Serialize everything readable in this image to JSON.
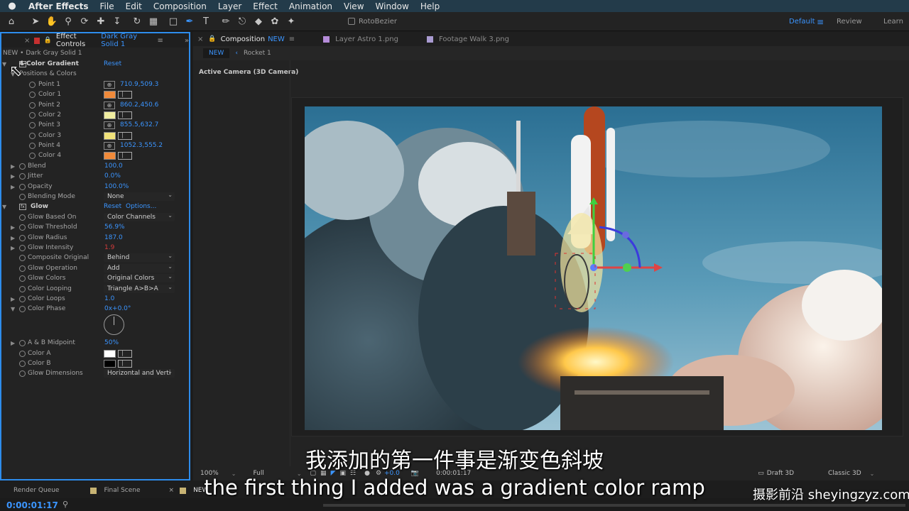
{
  "menubar": {
    "apple_icon": "apple-icon",
    "items": [
      "After Effects",
      "File",
      "Edit",
      "Composition",
      "Layer",
      "Effect",
      "Animation",
      "View",
      "Window",
      "Help"
    ]
  },
  "toolbar": {
    "rotobezier_label": "RotoBezier",
    "workspaces": {
      "default": "Default",
      "menu": "≡",
      "review": "Review",
      "learn": "Learn"
    }
  },
  "effect_controls": {
    "tab_title": "Effect Controls",
    "tab_layer": "Dark Gray Solid 1",
    "header": "NEW • Dark Gray Solid 1",
    "gradient": {
      "name": "4-Color Gradient",
      "reset": "Reset",
      "group": "Positions & Colors",
      "point1_label": "Point 1",
      "point1_value": "710.9,509.3",
      "color1_label": "Color 1",
      "color1": "#f08a3a",
      "point2_label": "Point 2",
      "point2_value": "860.2,450.6",
      "color2_label": "Color 2",
      "color2": "#f0eda0",
      "point3_label": "Point 3",
      "point3_value": "855.5,632.7",
      "color3_label": "Color 3",
      "color3": "#f0e27a",
      "point4_label": "Point 4",
      "point4_value": "1052.3,555.2",
      "color4_label": "Color 4",
      "color4": "#f08a3a",
      "blend_label": "Blend",
      "blend_value": "100.0",
      "jitter_label": "Jitter",
      "jitter_value": "0.0%",
      "opacity_label": "Opacity",
      "opacity_value": "100.0%",
      "blending_mode_label": "Blending Mode",
      "blending_mode_value": "None"
    },
    "glow": {
      "name": "Glow",
      "reset": "Reset",
      "options": "Options...",
      "based_on_label": "Glow Based On",
      "based_on_value": "Color Channels",
      "threshold_label": "Glow Threshold",
      "threshold_value": "56.9%",
      "radius_label": "Glow Radius",
      "radius_value": "187.0",
      "intensity_label": "Glow Intensity",
      "intensity_value": "1.9",
      "composite_label": "Composite Original",
      "composite_value": "Behind",
      "operation_label": "Glow Operation",
      "operation_value": "Add",
      "colors_label": "Glow Colors",
      "colors_value": "Original Colors",
      "looping_label": "Color Looping",
      "looping_value": "Triangle A>B>A",
      "loops_label": "Color Loops",
      "loops_value": "1.0",
      "phase_label": "Color Phase",
      "phase_value": "0x+0.0°",
      "midpoint_label": "A & B Midpoint",
      "midpoint_value": "50%",
      "color_a_label": "Color A",
      "color_a": "#ffffff",
      "color_b_label": "Color B",
      "color_b": "#000000",
      "dimensions_label": "Glow Dimensions",
      "dimensions_value": "Horizontal and Verti"
    }
  },
  "composition": {
    "tabs": [
      {
        "label": "Composition",
        "sub": "NEW"
      },
      {
        "label": "Layer Astro 1.png"
      },
      {
        "label": "Footage Walk 3.png"
      }
    ],
    "breadcrumb_new": "NEW",
    "breadcrumb_rocket": "Rocket 1",
    "camera_label": "Active Camera (3D Camera)",
    "footer": {
      "zoom": "100%",
      "resolution": "Full",
      "offset": "+0.0",
      "timecode": "0:00:01:17",
      "draft": "Draft 3D",
      "renderer": "Classic 3D"
    }
  },
  "timeline": {
    "tabs": [
      "Render Queue",
      "Final Scene",
      "NEW"
    ],
    "timecode": "0:00:01:17"
  },
  "subtitles": {
    "chinese": "我添加的第一件事是渐变色斜坡",
    "english": "the first thing I added was a gradient color ramp"
  },
  "watermark": "摄影前沿 sheyingzyz.com"
}
